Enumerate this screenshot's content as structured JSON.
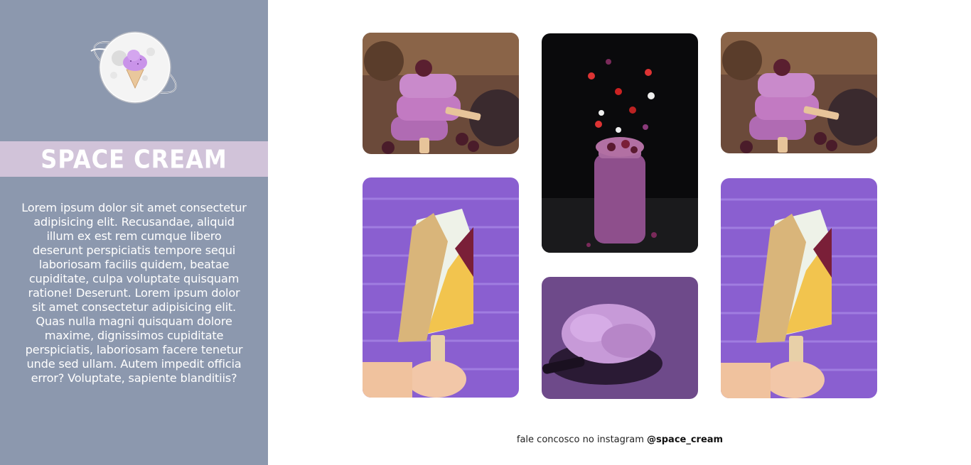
{
  "brand": {
    "logo_icon": "ice-cream-planet-icon",
    "title": "SPACE CREAM"
  },
  "about": {
    "text": "Lorem ipsum dolor sit amet consectetur adipisicing elit. Recusandae, aliquid illum ex est rem cumque libero deserunt perspiciatis tempore sequi laboriosam facilis quidem, beatae cupiditate, culpa voluptate quisquam ratione! Deserunt. Lorem ipsum dolor sit amet consectetur adipisicing elit. Quas nulla magni quisquam dolore maxime, dignissimos cupiditate perspiciatis, laboriosam facere tenetur unde sed ullam. Autem impedit officia error? Voluptate, sapiente blanditiis?"
  },
  "gallery": {
    "photos": [
      "berry-popsicles-photo",
      "berry-smoothie-jar-photo",
      "berry-popsicles-photo",
      "nut-dipped-popsicle-photo",
      "purple-ice-cream-spoon-photo",
      "nut-dipped-popsicle-photo"
    ]
  },
  "footer": {
    "text": "fale concosco no instagram ",
    "handle": "@space_cream"
  },
  "colors": {
    "sidebar": "#8c98ae",
    "title_band": "#d1c3d9",
    "accent_purple": "#8a5fd0"
  }
}
